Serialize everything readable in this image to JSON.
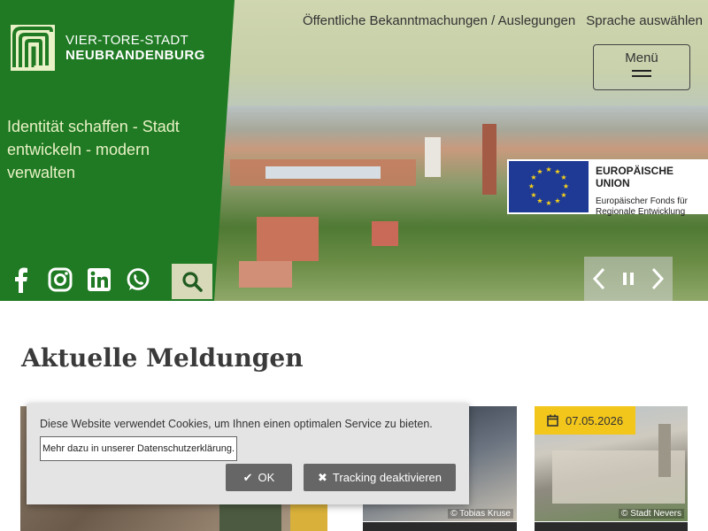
{
  "header": {
    "logo_line1": "VIER-TORE-STADT",
    "logo_line2": "NEUBRANDENBURG",
    "tagline": "Identität schaffen - Stadt entwickeln - modern verwalten",
    "nav": {
      "announcements": "Öffentliche Bekanntmachungen / Auslegungen",
      "language": "Sprache auswählen"
    },
    "menu_label": "Menü",
    "social_icons": [
      "facebook-icon",
      "instagram-icon",
      "linkedin-icon",
      "whatsapp-icon"
    ],
    "search_icon": "search-icon"
  },
  "eu_badge": {
    "title": "EUROPÄISCHE UNION",
    "subtitle": "Europäischer Fonds für Regionale Entwicklung"
  },
  "section": {
    "title": "Aktuelle Meldungen"
  },
  "cards": [
    {
      "credit": ""
    },
    {
      "credit": "© Tobias Kruse"
    },
    {
      "date": "07.05.2026",
      "credit": "© Stadt Nevers"
    }
  ],
  "cookie_banner": {
    "message": "Diese Website verwendet Cookies, um Ihnen einen optimalen Service zu bieten.",
    "link": "Mehr dazu in unserer Datenschutzerklärung.",
    "ok": "OK",
    "decline": "Tracking deaktivieren"
  },
  "colors": {
    "brand_green": "#1f7a23",
    "tagline": "#e9f1c6",
    "date_badge": "#f3c61b"
  }
}
